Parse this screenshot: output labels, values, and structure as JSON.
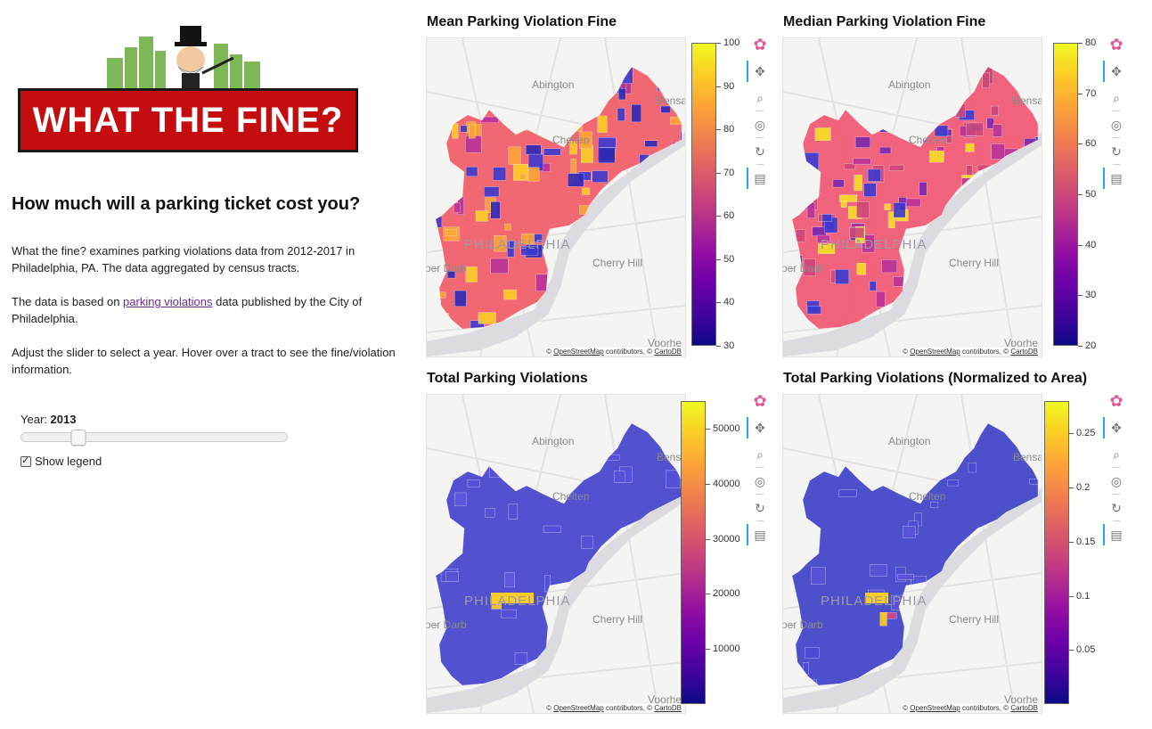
{
  "page": {
    "logo_text": "WHAT THE FINE?",
    "heading": "How much will a parking ticket cost you?",
    "paragraph1": "What the fine? examines parking violations data from 2012-2017 in Philadelphia, PA. The data aggregated by census tracts.",
    "paragraph2_pre": "The data is based on ",
    "paragraph2_link": "parking violations",
    "paragraph2_post": " data published by the City of Philadelphia.",
    "paragraph3": "Adjust the slider to select a year. Hover over a tract to see the fine/violation information."
  },
  "controls": {
    "year_label": "Year: ",
    "year_value": "2013",
    "year_min": 2012,
    "year_max": 2017,
    "show_legend_label": "Show legend",
    "show_legend_checked": true
  },
  "map_labels": {
    "abington": "Abington",
    "cheltenham": "Chelten",
    "philadelphia": "PHILADELPHIA",
    "cherry_hill": "Cherry Hill",
    "upper_darby": "per Darb",
    "voorhees": "Voorhe",
    "bensalem": "Bensal",
    "attribution_pre": "© ",
    "attribution_osm": "OpenStreetMap",
    "attribution_mid": " contributors, © ",
    "attribution_carto": "CartoDB"
  },
  "toolbar": {
    "icons": [
      "bokeh-logo-icon",
      "pan-icon",
      "box-zoom-icon",
      "wheel-zoom-icon",
      "reset-icon",
      "hover-icon"
    ]
  },
  "panels": [
    {
      "title": "Mean Parking Violation Fine",
      "colorbar_ticks": [
        "100",
        "90",
        "80",
        "70",
        "60",
        "50",
        "40",
        "30"
      ],
      "colorbar_range": [
        30,
        100
      ]
    },
    {
      "title": "Median Parking Violation Fine",
      "colorbar_ticks": [
        "80",
        "70",
        "60",
        "50",
        "40",
        "30",
        "20"
      ],
      "colorbar_range": [
        20,
        80
      ]
    },
    {
      "title": "Total Parking Violations",
      "colorbar_ticks": [
        "50000",
        "40000",
        "30000",
        "20000",
        "10000"
      ],
      "colorbar_range": [
        0,
        55000
      ]
    },
    {
      "title": "Total Parking Violations (Normalized to Area)",
      "colorbar_ticks": [
        "0.25",
        "0.2",
        "0.15",
        "0.1",
        "0.05"
      ],
      "colorbar_range": [
        0,
        0.28
      ]
    }
  ],
  "colors": {
    "logo_red": "#c40d0e",
    "link": "#6b2d8e",
    "toolbar_active": "#26aae1",
    "colormap": "plasma"
  }
}
